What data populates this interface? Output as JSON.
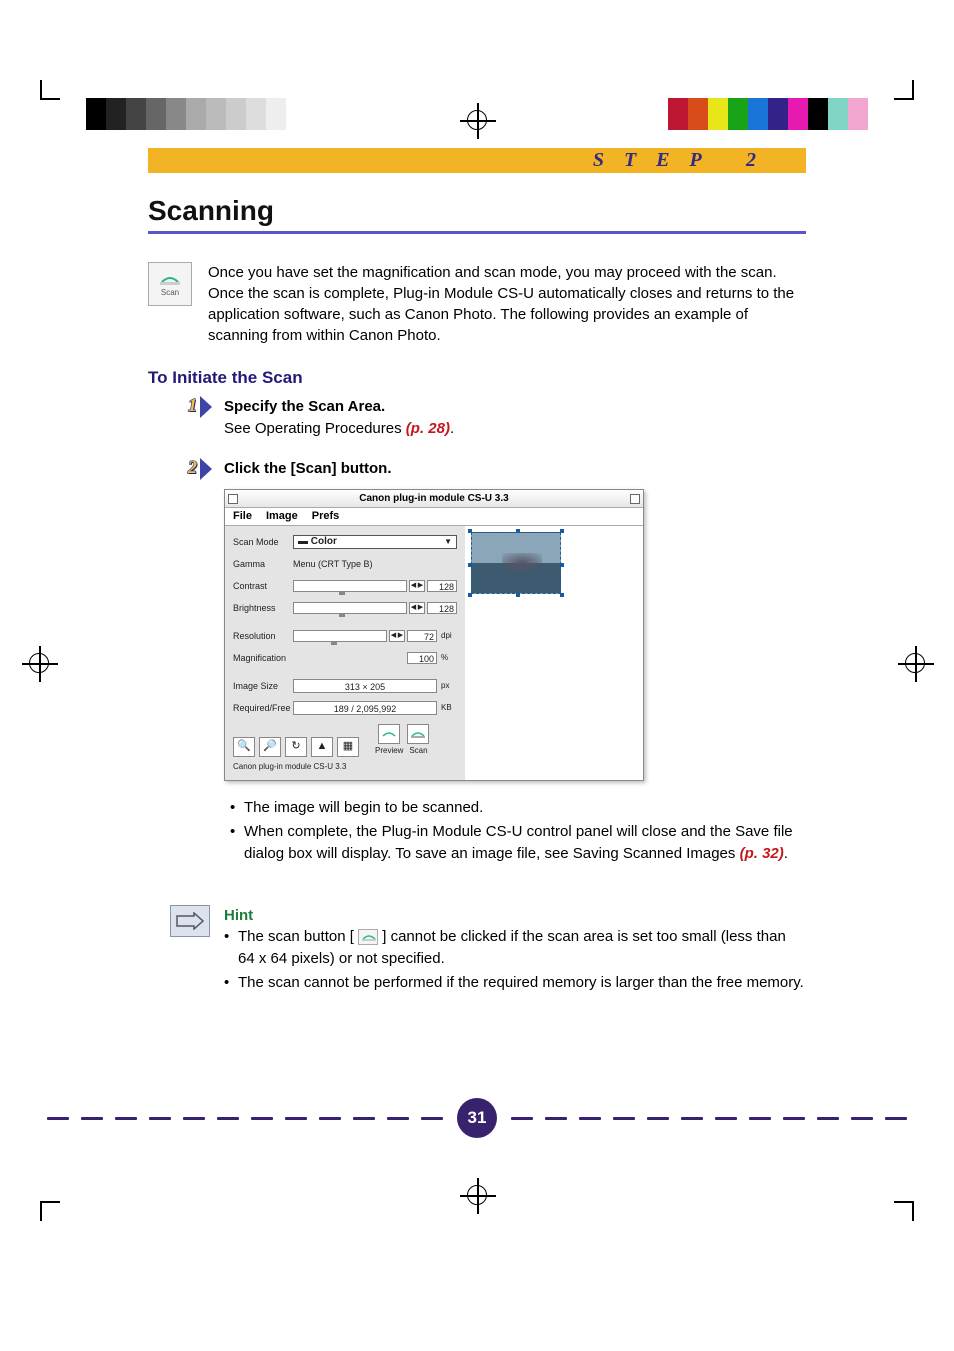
{
  "header": {
    "step_label": "STEP 2",
    "title": "Scanning"
  },
  "intro": {
    "icon_label": "Scan",
    "text": "Once you have set the magnification and scan mode, you may proceed with the scan. Once the scan is complete, Plug-in Module CS-U automatically closes and returns to the application software, such as Canon Photo. The following provides an example of scanning from within Canon Photo."
  },
  "section_title": "To Initiate the Scan",
  "steps": [
    {
      "num": "1",
      "title": "Specify the Scan Area.",
      "body_before": "See Operating Procedures ",
      "ref": "(p. 28)",
      "body_after": "."
    },
    {
      "num": "2",
      "title": "Click the [Scan] button."
    }
  ],
  "screenshot": {
    "title": "Canon plug-in module CS-U 3.3",
    "menu": [
      "File",
      "Image",
      "Prefs"
    ],
    "rows": {
      "scan_mode_label": "Scan Mode",
      "scan_mode_value": "Color",
      "gamma_label": "Gamma",
      "gamma_value": "Menu (CRT Type B)",
      "contrast_label": "Contrast",
      "contrast_value": "128",
      "brightness_label": "Brightness",
      "brightness_value": "128",
      "resolution_label": "Resolution",
      "resolution_value": "72",
      "resolution_unit": "dpi",
      "magnification_label": "Magnification",
      "magnification_value": "100",
      "magnification_unit": "%",
      "image_size_label": "Image Size",
      "image_size_value": "313 × 205",
      "image_size_unit": "px",
      "required_label": "Required/Free",
      "required_value": "189 / 2,095,992",
      "required_unit": "KB"
    },
    "buttons": {
      "preview": "Preview",
      "scan": "Scan"
    },
    "status": "Canon plug-in module CS-U 3.3"
  },
  "bullets": [
    "The image will begin to be scanned.",
    "When complete, the Plug-in Module CS-U control panel will close and the Save file dialog box will display. To save an image file, see Saving Scanned Images "
  ],
  "bullets_ref": "(p. 32)",
  "bullets_after": ".",
  "hint": {
    "title": "Hint",
    "items_pre": "The scan button [",
    "items_post": "] cannot be clicked if the scan area is set too small (less than 64 x 64 pixels) or not specified.",
    "item2": "The scan cannot be performed if the required memory is larger than the free memory."
  },
  "page_number": "31"
}
